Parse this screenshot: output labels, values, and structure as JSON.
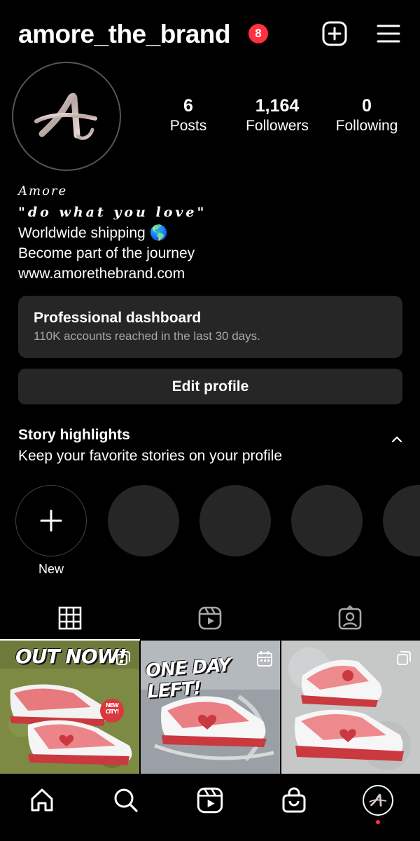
{
  "header": {
    "username": "amore_the_brand",
    "notification_count": "8",
    "new_post_icon": "plus-square-icon",
    "menu_icon": "hamburger-menu-icon"
  },
  "profile": {
    "stats": [
      {
        "value": "6",
        "label": "Posts"
      },
      {
        "value": "1,164",
        "label": "Followers"
      },
      {
        "value": "0",
        "label": "Following"
      }
    ],
    "bio": {
      "name": "Amore",
      "quote": "\"do what you love\"",
      "lines": [
        "Worldwide shipping 🌎",
        "Become part of the journey",
        "www.amorethebrand.com"
      ]
    }
  },
  "dashboard": {
    "title": "Professional dashboard",
    "subtitle": "110K accounts reached in the last 30 days."
  },
  "edit_profile_label": "Edit profile",
  "highlights": {
    "title": "Story highlights",
    "subtitle": "Keep your favorite stories on your profile",
    "new_label": "New"
  },
  "tabs": [
    "grid-icon",
    "reels-icon",
    "tagged-icon"
  ],
  "posts": [
    {
      "overlay": "OUT NOW!",
      "badge": "NEW CITY!",
      "icon": "carousel-icon"
    },
    {
      "overlay": "ONE DAY LEFT!",
      "icon": "calendar-icon"
    },
    {
      "overlay": "",
      "icon": "carousel-icon"
    }
  ],
  "bottom_nav": [
    "home-icon",
    "search-icon",
    "reels-icon",
    "shop-icon",
    "profile-avatar"
  ],
  "colors": {
    "background": "#000000",
    "surface": "#262626",
    "badge": "#ff3040",
    "muted_text": "#a8a8a8"
  }
}
